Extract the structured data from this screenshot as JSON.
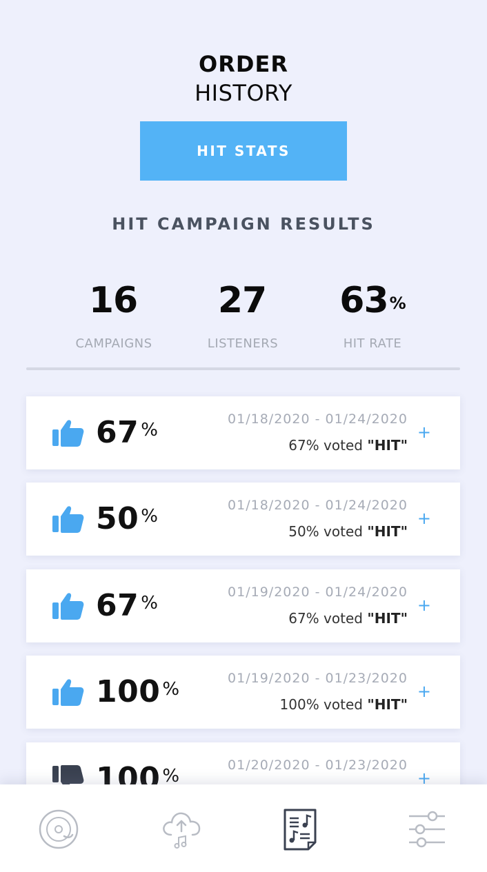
{
  "header": {
    "title_line1": "ORDER",
    "title_line2": "HISTORY"
  },
  "hit_stats_button": {
    "label": "HIT STATS"
  },
  "section_title": "HIT CAMPAIGN RESULTS",
  "stats": [
    {
      "value": "16",
      "suffix": "",
      "label": "CAMPAIGNS"
    },
    {
      "value": "27",
      "suffix": "",
      "label": "LISTENERS"
    },
    {
      "value": "63",
      "suffix": "%",
      "label": "HIT RATE"
    }
  ],
  "campaigns": [
    {
      "percent": "67",
      "percent_sign": "%",
      "dates": "01/18/2020 - 01/24/2020",
      "voted_text": "67% voted",
      "voted_label": "\"HIT\"",
      "expand": "+",
      "icon": "thumbs-up-icon",
      "icon_color": "#4aa8f0"
    },
    {
      "percent": "50",
      "percent_sign": "%",
      "dates": "01/18/2020 - 01/24/2020",
      "voted_text": "50% voted",
      "voted_label": "\"HIT\"",
      "expand": "+",
      "icon": "thumbs-up-icon",
      "icon_color": "#4aa8f0"
    },
    {
      "percent": "67",
      "percent_sign": "%",
      "dates": "01/19/2020 - 01/24/2020",
      "voted_text": "67% voted",
      "voted_label": "\"HIT\"",
      "expand": "+",
      "icon": "thumbs-up-icon",
      "icon_color": "#4aa8f0"
    },
    {
      "percent": "100",
      "percent_sign": "%",
      "dates": "01/19/2020 - 01/23/2020",
      "voted_text": "100% voted",
      "voted_label": "\"HIT\"",
      "expand": "+",
      "icon": "thumbs-up-icon",
      "icon_color": "#4aa8f0"
    },
    {
      "percent": "100",
      "percent_sign": "%",
      "dates": "01/20/2020 - 01/23/2020",
      "voted_text": "",
      "voted_label": "",
      "expand": "+",
      "icon": "thumbs-down-icon",
      "icon_color": "#3a4150"
    }
  ],
  "bottom_nav": [
    {
      "icon": "vinyl-record-icon",
      "active": false
    },
    {
      "icon": "cloud-upload-music-icon",
      "active": false
    },
    {
      "icon": "music-sheet-icon",
      "active": true
    },
    {
      "icon": "sliders-icon",
      "active": false
    }
  ],
  "colors": {
    "accent": "#53b3f6",
    "background": "#eef0fc",
    "muted_text": "#a4a9b3",
    "nav_icon": "#b8bcc4",
    "nav_icon_active": "#3a4150"
  }
}
